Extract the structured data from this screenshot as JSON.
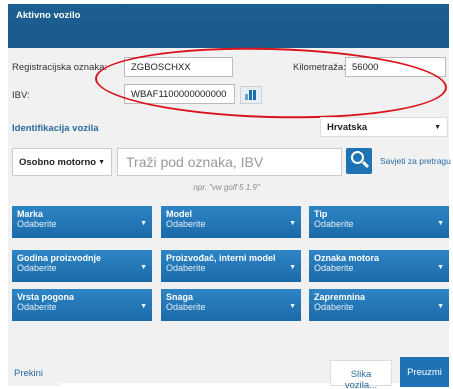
{
  "window": {
    "title": "Aktivno vozilo"
  },
  "vehicle": {
    "reg_label": "Registracijska oznaka:",
    "reg_value": "ZGBOSCHXX",
    "km_label": "Kilometraža:",
    "km_value": "56000",
    "vin_label": "IBV:",
    "vin_value": "WBAF1100000000000"
  },
  "identification": {
    "section_title": "Identifikacija vozila",
    "country": "Hrvatska",
    "category": "Osobno motorno",
    "search_placeholder": "Traži pod oznaka, IBV",
    "tips_link": "Savjeti za pretragu",
    "hint": "npr. \"vw golf 5 1.9\""
  },
  "filters": [
    {
      "title": "Marka",
      "value": "Odaberite"
    },
    {
      "title": "Model",
      "value": "Odaberite"
    },
    {
      "title": "Tip",
      "value": "Odaberite"
    },
    {
      "title": "Godina proizvodnje",
      "value": "Odaberite"
    },
    {
      "title": "Proizvođač, interni model",
      "value": "Odaberite"
    },
    {
      "title": "Oznaka motora",
      "value": "Odaberite"
    },
    {
      "title": "Vrsta pogona",
      "value": "Odaberite"
    },
    {
      "title": "Snaga",
      "value": "Odaberite"
    },
    {
      "title": "Zapremnina",
      "value": "Odaberite"
    }
  ],
  "footer": {
    "cancel": "Prekini",
    "vehicle_image": "Slika vozila...",
    "take": "Preuzmi"
  },
  "colors": {
    "accent": "#1e73b5",
    "highlight": "#d9131b"
  }
}
